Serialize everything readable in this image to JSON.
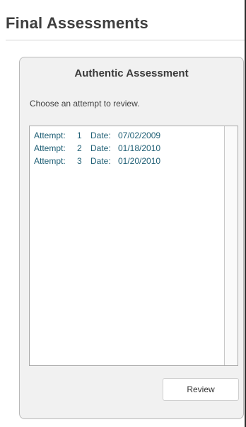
{
  "page": {
    "title": "Final Assessments"
  },
  "panel": {
    "heading": "Authentic Assessment",
    "instruction": "Choose an attempt to review."
  },
  "attempts": [
    {
      "label": "Attempt:",
      "number": "1",
      "date_label": "Date:",
      "date": "07/02/2009"
    },
    {
      "label": "Attempt:",
      "number": "2",
      "date_label": "Date:",
      "date": "01/18/2010"
    },
    {
      "label": "Attempt:",
      "number": "3",
      "date_label": "Date:",
      "date": "01/20/2010"
    }
  ],
  "actions": {
    "review_label": "Review"
  },
  "colors": {
    "list_text": "#1f5f75",
    "panel_bg": "#f1f1f1"
  }
}
